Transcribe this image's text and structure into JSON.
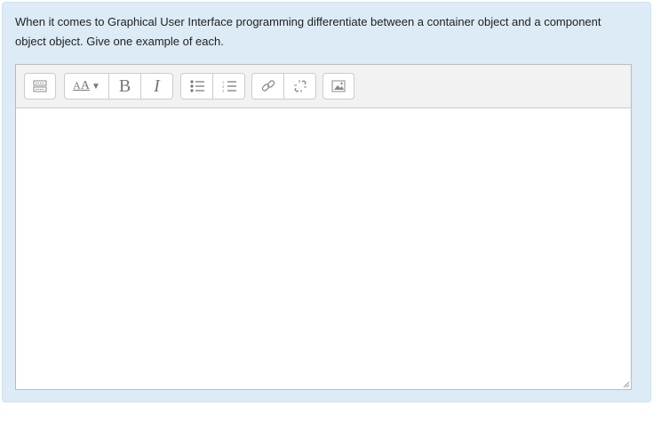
{
  "question": {
    "text": "When it comes to Graphical User Interface programming differentiate between a container object and a component object object. Give one example of each."
  },
  "editor": {
    "value": "",
    "toolbar": [
      {
        "group": "toggle",
        "buttons": [
          {
            "name": "show-more-buttons",
            "icon": "toolbar-toggle-icon"
          }
        ]
      },
      {
        "group": "style",
        "buttons": [
          {
            "name": "paragraph-styles",
            "icon": "font-size-icon"
          },
          {
            "name": "bold",
            "label": "B"
          },
          {
            "name": "italic",
            "label": "I"
          }
        ]
      },
      {
        "group": "list",
        "buttons": [
          {
            "name": "unordered-list",
            "icon": "bullet-list-icon"
          },
          {
            "name": "ordered-list",
            "icon": "numbered-list-icon"
          }
        ]
      },
      {
        "group": "link",
        "buttons": [
          {
            "name": "link",
            "icon": "link-icon"
          },
          {
            "name": "unlink",
            "icon": "unlink-icon"
          }
        ]
      },
      {
        "group": "image",
        "buttons": [
          {
            "name": "insert-image",
            "icon": "image-icon"
          }
        ]
      }
    ]
  }
}
